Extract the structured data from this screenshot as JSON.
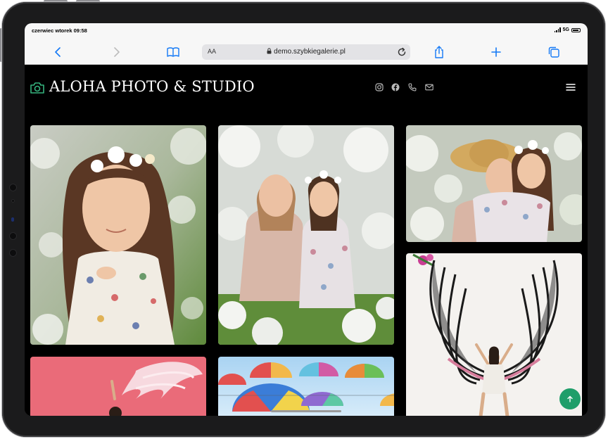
{
  "status": {
    "time": "czerwiec wtorek 09:58",
    "network": "5G"
  },
  "browser": {
    "text_size_label": "AA",
    "url": "demo.szybkiegalerie.pl"
  },
  "site": {
    "brand": "ALOHA PHOTO & STUDIO",
    "accent": "#35b37e"
  },
  "gallery": [
    {
      "subject": "girl-with-flower-crown-in-blossoms"
    },
    {
      "subject": "mother-and-daughter-in-blossoms"
    },
    {
      "subject": "mother-in-straw-hat-hugging-daughter"
    },
    {
      "subject": "woman-with-angel-wings-mural"
    },
    {
      "subject": "woman-with-pink-wing-mural"
    },
    {
      "subject": "rainbow-umbrellas"
    }
  ],
  "colors": {
    "scroll_top": "#1f9e6a"
  }
}
